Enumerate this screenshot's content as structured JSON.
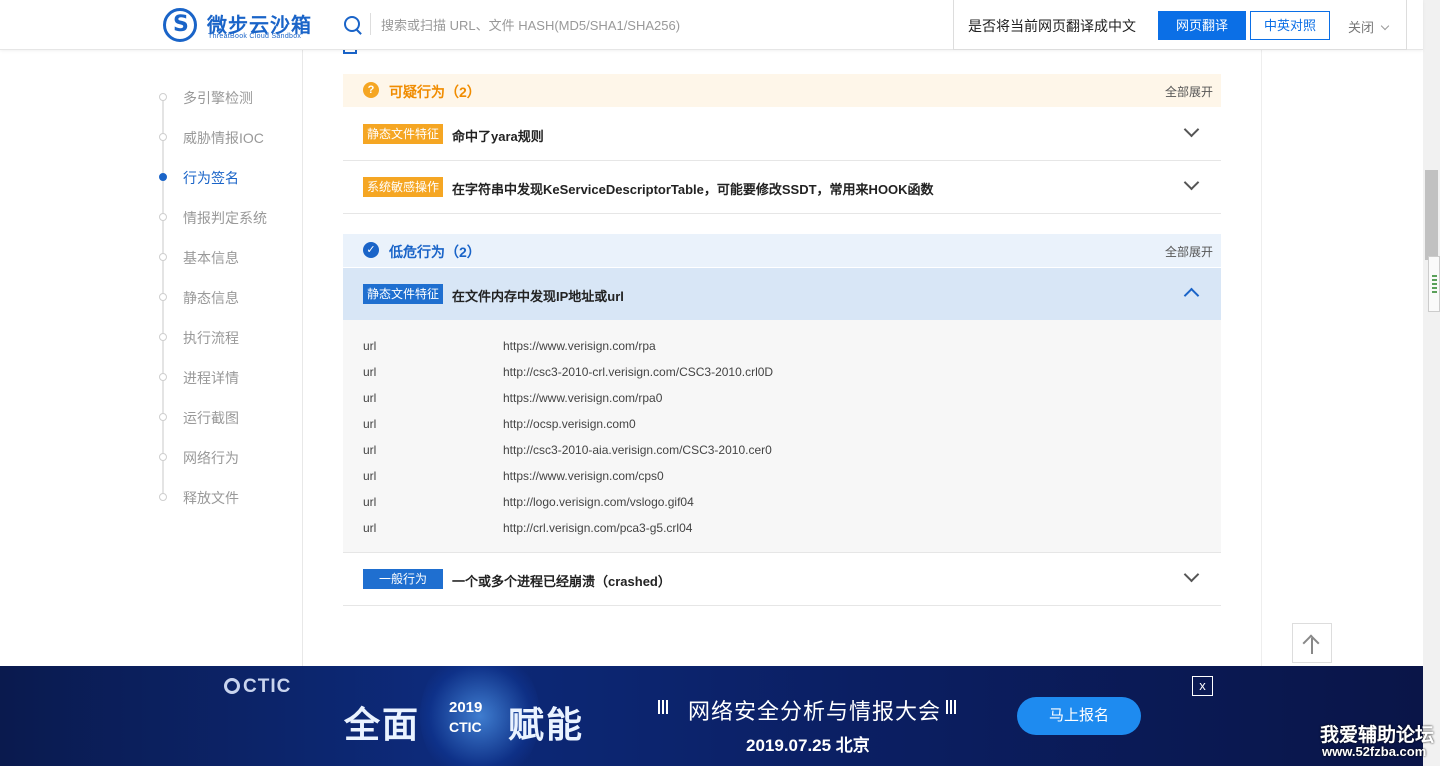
{
  "header": {
    "logo_title": "微步云沙箱",
    "logo_subtitle": "ThreatBook Cloud Sandbox",
    "search_placeholder": "搜索或扫描 URL、文件 HASH(MD5/SHA1/SHA256)"
  },
  "translate_bar": {
    "prompt": "是否将当前网页翻译成中文",
    "translate_button": "网页翻译",
    "bilingual_button": "中英对照",
    "close_button": "关闭"
  },
  "sidebar": {
    "items": [
      {
        "label": "多引擎检测",
        "active": false
      },
      {
        "label": "威胁情报IOC",
        "active": false
      },
      {
        "label": "行为签名",
        "active": true
      },
      {
        "label": "情报判定系统",
        "active": false
      },
      {
        "label": "基本信息",
        "active": false
      },
      {
        "label": "静态信息",
        "active": false
      },
      {
        "label": "执行流程",
        "active": false
      },
      {
        "label": "进程详情",
        "active": false
      },
      {
        "label": "运行截图",
        "active": false
      },
      {
        "label": "网络行为",
        "active": false
      },
      {
        "label": "释放文件",
        "active": false
      }
    ]
  },
  "groups": {
    "suspicious": {
      "icon": "?",
      "title": "可疑行为（2）",
      "expand_all": "全部展开",
      "rows": [
        {
          "tag": "静态文件特征",
          "text": "命中了yara规则"
        },
        {
          "tag": "系统敏感操作",
          "text": "在字符串中发现KeServiceDescriptorTable，可能要修改SSDT，常用来HOOK函数"
        }
      ]
    },
    "low_risk": {
      "icon": "✓",
      "title": "低危行为（2）",
      "expand_all": "全部展开",
      "rows": [
        {
          "tag": "静态文件特征",
          "text": "在文件内存中发现IP地址或url"
        },
        {
          "tag": "一般行为",
          "text": "一个或多个进程已经崩溃（crashed）"
        }
      ],
      "details": [
        {
          "key": "url",
          "value": "https://www.verisign.com/rpa"
        },
        {
          "key": "url",
          "value": "http://csc3-2010-crl.verisign.com/CSC3-2010.crl0D"
        },
        {
          "key": "url",
          "value": "https://www.verisign.com/rpa0"
        },
        {
          "key": "url",
          "value": "http://ocsp.verisign.com0"
        },
        {
          "key": "url",
          "value": "http://csc3-2010-aia.verisign.com/CSC3-2010.cer0"
        },
        {
          "key": "url",
          "value": "https://www.verisign.com/cps0"
        },
        {
          "key": "url",
          "value": "http://logo.verisign.com/vslogo.gif04"
        },
        {
          "key": "url",
          "value": "http://crl.verisign.com/pca3-g5.crl04"
        }
      ]
    }
  },
  "banner": {
    "brand": "CTIC",
    "slogan_left": "全面",
    "slogan_right": "赋能",
    "year": "2019",
    "year_sub": "CTIC",
    "event_title": "网络安全分析与情报大会",
    "event_date": "2019.07.25  北京",
    "signup_button": "马上报名",
    "close": "x"
  },
  "watermark": {
    "name": "我爱辅助论坛",
    "url": "www.52fzba.com"
  },
  "colors": {
    "primary": "#1a64c8",
    "warn": "#f5a623",
    "tag_blue": "#1f6fd0"
  }
}
